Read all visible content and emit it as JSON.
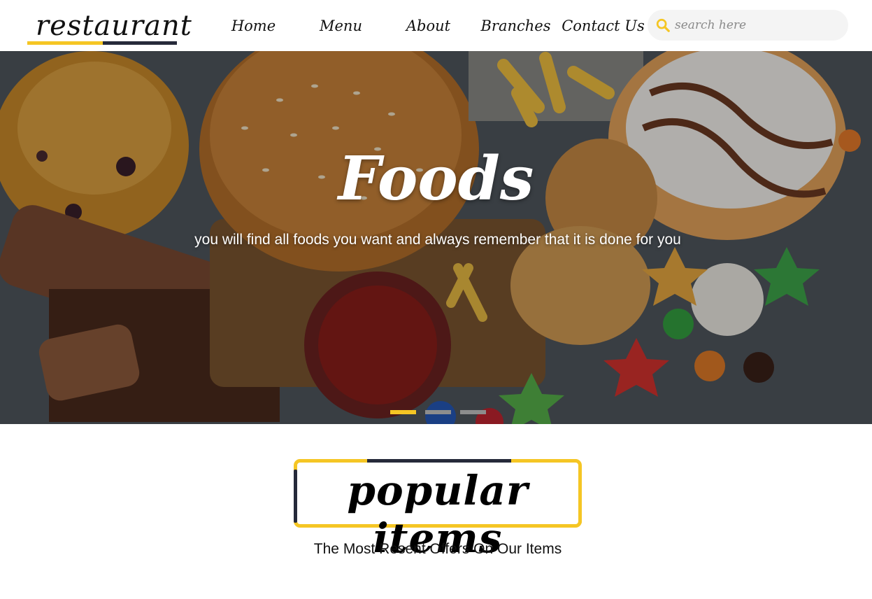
{
  "header": {
    "logo_text": "restaurant",
    "nav": [
      {
        "label": "Home"
      },
      {
        "label": "Menu"
      },
      {
        "label": "About"
      },
      {
        "label": "Branches"
      },
      {
        "label": "Contact Us"
      }
    ],
    "search": {
      "placeholder": "search here",
      "icon": "search-icon"
    }
  },
  "hero": {
    "title": "Foods",
    "subtitle": "you will find all foods you want and always remember that it is done for you",
    "slides": {
      "count": 3,
      "active_index": 0
    }
  },
  "popular": {
    "title": "popular items",
    "subtitle": "The Most Resent Offers On Our Items"
  },
  "colors": {
    "accent": "#f5c624",
    "dark": "#262a3a"
  }
}
